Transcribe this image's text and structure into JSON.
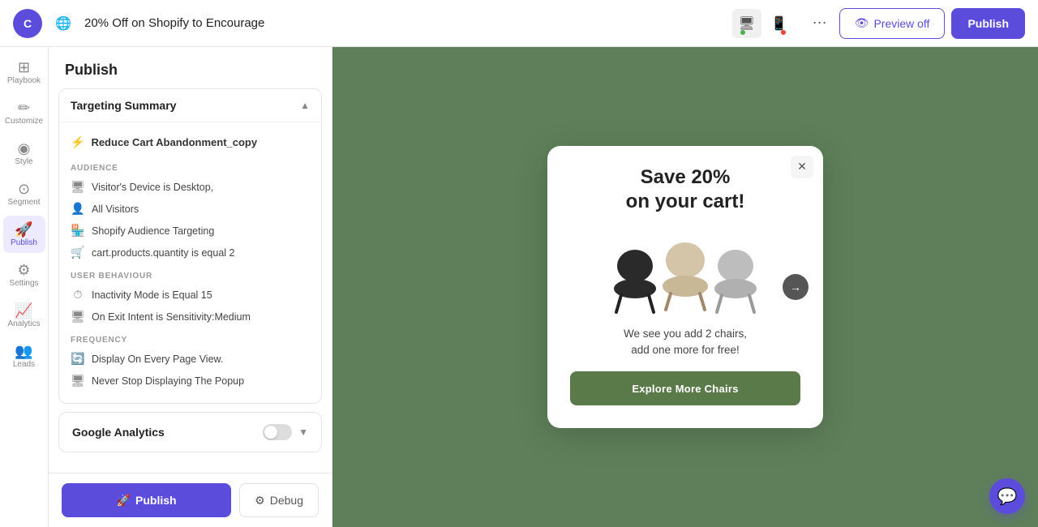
{
  "topbar": {
    "logo_text": "C",
    "title": "20% Off on Shopify to Encourage",
    "preview_label": "Preview off",
    "publish_label": "Publish",
    "more_icon": "⋯"
  },
  "devices": {
    "desktop_icon": "🖥",
    "mobile_icon": "📱"
  },
  "sidebar": {
    "items": [
      {
        "id": "playbook",
        "icon": "⊞",
        "label": "Playbook"
      },
      {
        "id": "customize",
        "icon": "✏",
        "label": "Customize"
      },
      {
        "id": "style",
        "icon": "◉",
        "label": "Style"
      },
      {
        "id": "segment",
        "icon": "⊙",
        "label": "Segment"
      },
      {
        "id": "publish",
        "icon": "🚀",
        "label": "Publish",
        "active": true
      },
      {
        "id": "settings",
        "icon": "⚙",
        "label": "Settings"
      },
      {
        "id": "analytics",
        "icon": "📈",
        "label": "Analytics"
      },
      {
        "id": "leads",
        "icon": "👥",
        "label": "Leads"
      },
      {
        "id": "chat",
        "icon": "💬",
        "label": ""
      }
    ]
  },
  "panel": {
    "title": "Publish",
    "targeting_summary": {
      "section_label": "Targeting Summary",
      "rule_name": "Reduce Cart Abandonment_copy",
      "rule_icon": "⚡",
      "audience_label": "AUDIENCE",
      "audience_items": [
        {
          "icon": "🖥",
          "text": "Visitor's Device is Desktop,"
        },
        {
          "icon": "👤",
          "text": "All Visitors"
        },
        {
          "icon": "🏪",
          "text": "Shopify Audience Targeting"
        },
        {
          "icon": "",
          "text": "cart.products.quantity is equal 2"
        }
      ],
      "behaviour_label": "USER BEHAVIOUR",
      "behaviour_items": [
        {
          "icon": "⏱",
          "text": "Inactivity Mode is Equal 15"
        },
        {
          "icon": "🖥",
          "text": "On Exit Intent is Sensitivity:Medium"
        }
      ],
      "frequency_label": "FREQUENCY",
      "frequency_items": [
        {
          "icon": "🔄",
          "text": "Display On Every Page View."
        },
        {
          "icon": "🖥",
          "text": "Never Stop Displaying The Popup"
        }
      ]
    },
    "google_analytics": {
      "label": "Google Analytics"
    },
    "publish_btn": "Publish",
    "debug_btn": "Debug"
  },
  "popup": {
    "title_line1": "Save 20%",
    "title_line2": "on your cart!",
    "body_text_line1": "We see you add 2 chairs,",
    "body_text_line2": "add one more for free!",
    "cta_label": "Explore More Chairs",
    "close_icon": "✕",
    "arrow_icon": "→"
  }
}
